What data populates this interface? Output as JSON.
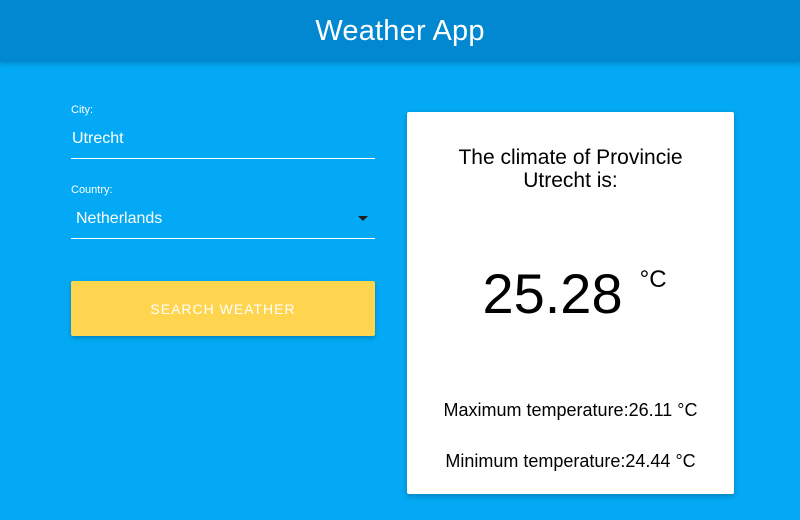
{
  "header": {
    "title": "Weather App"
  },
  "form": {
    "city_label": "City:",
    "city_value": "Utrecht",
    "country_label": "Country:",
    "country_value": "Netherlands",
    "search_label": "Search Weather"
  },
  "card": {
    "heading": "The climate of Provincie Utrecht is:",
    "temperature": "25.28",
    "unit": "°C",
    "max_label": "Maximum temperature:26.11 °C",
    "min_label": "Minimum temperature:24.44 °C"
  },
  "colors": {
    "background": "#03a9f4",
    "app_bar": "#0288d1",
    "button": "#ffd54f",
    "card": "#ffffff"
  },
  "icons": {
    "country_dropdown": "chevron-down-icon"
  }
}
